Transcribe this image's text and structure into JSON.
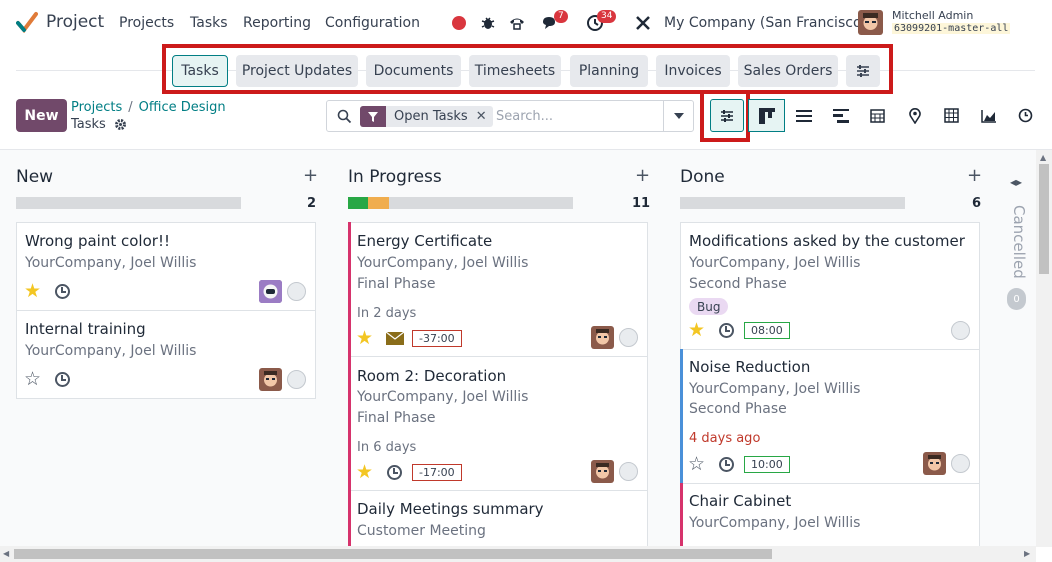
{
  "app": {
    "name": "Project"
  },
  "nav": {
    "projects": "Projects",
    "tasks": "Tasks",
    "reporting": "Reporting",
    "configuration": "Configuration"
  },
  "systray": {
    "messages_count": "7",
    "activities_count": "34",
    "company": "My Company (San Francisco)",
    "user": "Mitchell Admin",
    "database": "63099201-master-all"
  },
  "tabs": [
    "Tasks",
    "Project Updates",
    "Documents",
    "Timesheets",
    "Planning",
    "Invoices",
    "Sales Orders"
  ],
  "actions": {
    "new_label": "New"
  },
  "breadcrumb": {
    "projects": "Projects",
    "current_project": "Office Design",
    "page": "Tasks",
    "separator": "/"
  },
  "search": {
    "facet": "Open Tasks",
    "placeholder": "Search..."
  },
  "colors": {
    "accent": "#71496a",
    "teal": "#017e84",
    "highlight_red": "#cc1a1a"
  },
  "columns": [
    {
      "title": "New",
      "count": "2",
      "cards": [
        {
          "title": "Wrong paint color!!",
          "subtitle": "YourCompany, Joel Willis",
          "starred": true
        },
        {
          "title": "Internal training",
          "subtitle": "YourCompany, Joel Willis",
          "starred": false
        }
      ]
    },
    {
      "title": "In Progress",
      "count": "11",
      "cards": [
        {
          "title": "Energy Certificate",
          "subtitle": "YourCompany, Joel Willis",
          "phase": "Final Phase",
          "deadline": "In 2 days",
          "time": "-37:00",
          "starred": true
        },
        {
          "title": "Room 2: Decoration",
          "subtitle": "YourCompany, Joel Willis",
          "phase": "Final Phase",
          "deadline": "In 6 days",
          "time": "-17:00",
          "starred": true
        },
        {
          "title": "Daily Meetings summary",
          "subtitle": "Customer Meeting"
        }
      ]
    },
    {
      "title": "Done",
      "count": "6",
      "cards": [
        {
          "title": "Modifications asked by the customer",
          "subtitle": "YourCompany, Joel Willis",
          "phase": "Second Phase",
          "tag": "Bug",
          "time": "08:00",
          "starred": true
        },
        {
          "title": "Noise Reduction",
          "subtitle": "YourCompany, Joel Willis",
          "phase": "Second Phase",
          "deadline": "4 days ago",
          "time": "10:00",
          "starred": false
        },
        {
          "title": "Chair Cabinet",
          "subtitle": "YourCompany, Joel Willis"
        }
      ]
    }
  ],
  "folded_column": {
    "title": "Cancelled",
    "count": "0"
  }
}
